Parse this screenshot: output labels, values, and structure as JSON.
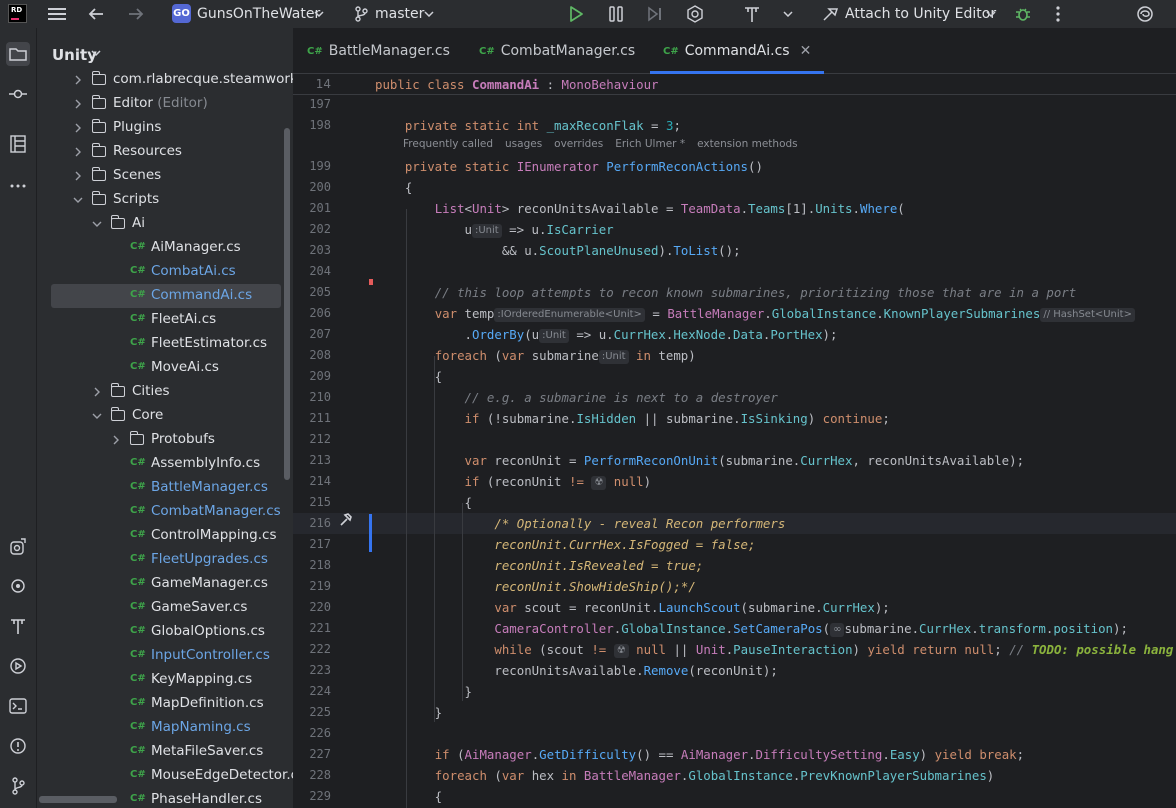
{
  "toolbar": {
    "logo_text": "RD",
    "project_badge": "GO",
    "project_name": "GunsOnTheWater",
    "branch": "master",
    "attach_label": "Attach to Unity Editor"
  },
  "project_panel": {
    "title": "Unity",
    "items": [
      {
        "label": "com.rlabrecque.steamworks.n",
        "kind": "folder",
        "depth": 1,
        "expanded": false,
        "color": "normal",
        "suffix": ""
      },
      {
        "label": "Editor",
        "kind": "folder",
        "depth": 1,
        "expanded": false,
        "color": "normal",
        "suffix": "(Editor)"
      },
      {
        "label": "Plugins",
        "kind": "folder",
        "depth": 1,
        "expanded": false,
        "color": "normal",
        "suffix": ""
      },
      {
        "label": "Resources",
        "kind": "folder",
        "depth": 1,
        "expanded": false,
        "color": "normal",
        "suffix": ""
      },
      {
        "label": "Scenes",
        "kind": "folder",
        "depth": 1,
        "expanded": false,
        "color": "normal",
        "suffix": ""
      },
      {
        "label": "Scripts",
        "kind": "folder",
        "depth": 1,
        "expanded": true,
        "color": "normal",
        "suffix": ""
      },
      {
        "label": "Ai",
        "kind": "folder",
        "depth": 2,
        "expanded": true,
        "color": "normal",
        "suffix": ""
      },
      {
        "label": "AiManager.cs",
        "kind": "file",
        "depth": 3,
        "color": "normal",
        "suffix": ""
      },
      {
        "label": "CombatAi.cs",
        "kind": "file",
        "depth": 3,
        "color": "blue",
        "suffix": ""
      },
      {
        "label": "CommandAi.cs",
        "kind": "file",
        "depth": 3,
        "color": "blue",
        "suffix": "",
        "selected": true
      },
      {
        "label": "FleetAi.cs",
        "kind": "file",
        "depth": 3,
        "color": "normal",
        "suffix": ""
      },
      {
        "label": "FleetEstimator.cs",
        "kind": "file",
        "depth": 3,
        "color": "normal",
        "suffix": ""
      },
      {
        "label": "MoveAi.cs",
        "kind": "file",
        "depth": 3,
        "color": "normal",
        "suffix": ""
      },
      {
        "label": "Cities",
        "kind": "folder",
        "depth": 2,
        "expanded": false,
        "color": "normal",
        "suffix": ""
      },
      {
        "label": "Core",
        "kind": "folder",
        "depth": 2,
        "expanded": true,
        "color": "normal",
        "suffix": ""
      },
      {
        "label": "Protobufs",
        "kind": "folder",
        "depth": 3,
        "expanded": false,
        "color": "normal",
        "suffix": ""
      },
      {
        "label": "AssemblyInfo.cs",
        "kind": "file",
        "depth": 3,
        "color": "normal",
        "suffix": ""
      },
      {
        "label": "BattleManager.cs",
        "kind": "file",
        "depth": 3,
        "color": "blue",
        "suffix": ""
      },
      {
        "label": "CombatManager.cs",
        "kind": "file",
        "depth": 3,
        "color": "blue",
        "suffix": ""
      },
      {
        "label": "ControlMapping.cs",
        "kind": "file",
        "depth": 3,
        "color": "normal",
        "suffix": ""
      },
      {
        "label": "FleetUpgrades.cs",
        "kind": "file",
        "depth": 3,
        "color": "blue",
        "suffix": ""
      },
      {
        "label": "GameManager.cs",
        "kind": "file",
        "depth": 3,
        "color": "normal",
        "suffix": ""
      },
      {
        "label": "GameSaver.cs",
        "kind": "file",
        "depth": 3,
        "color": "normal",
        "suffix": ""
      },
      {
        "label": "GlobalOptions.cs",
        "kind": "file",
        "depth": 3,
        "color": "normal",
        "suffix": ""
      },
      {
        "label": "InputController.cs",
        "kind": "file",
        "depth": 3,
        "color": "blue",
        "suffix": ""
      },
      {
        "label": "KeyMapping.cs",
        "kind": "file",
        "depth": 3,
        "color": "normal",
        "suffix": ""
      },
      {
        "label": "MapDefinition.cs",
        "kind": "file",
        "depth": 3,
        "color": "normal",
        "suffix": ""
      },
      {
        "label": "MapNaming.cs",
        "kind": "file",
        "depth": 3,
        "color": "blue",
        "suffix": ""
      },
      {
        "label": "MetaFileSaver.cs",
        "kind": "file",
        "depth": 3,
        "color": "normal",
        "suffix": ""
      },
      {
        "label": "MouseEdgeDetector.cs",
        "kind": "file",
        "depth": 3,
        "color": "normal",
        "suffix": ""
      },
      {
        "label": "PhaseHandler.cs",
        "kind": "file",
        "depth": 3,
        "color": "normal",
        "suffix": ""
      }
    ]
  },
  "tabs": [
    {
      "label": "BattleManager.cs",
      "active": false
    },
    {
      "label": "CombatManager.cs",
      "active": false
    },
    {
      "label": "CommandAi.cs",
      "active": true
    }
  ],
  "tab_lang": "C#",
  "editor": {
    "sticky": {
      "line": "14",
      "tokens": [
        [
          "kw",
          "public "
        ],
        [
          "kw",
          "class "
        ],
        [
          "tyb",
          "CommandAi"
        ],
        [
          "",
          "  : "
        ],
        [
          "ty",
          "MonoBehaviour"
        ]
      ]
    },
    "hints": [
      "Frequently called",
      "usages",
      "overrides",
      "Erich Ulmer *",
      "extension methods"
    ],
    "lines": [
      {
        "n": "197",
        "tokens": []
      },
      {
        "n": "198",
        "tokens": [
          [
            "",
            "    "
          ],
          [
            "kw",
            "private "
          ],
          [
            "kw",
            "static "
          ],
          [
            "kw",
            "int "
          ],
          [
            "fld",
            "_maxReconFlak"
          ],
          [
            "",
            " = "
          ],
          [
            "num",
            "3"
          ],
          [
            "",
            ";"
          ]
        ]
      },
      {
        "n": "",
        "hints": true
      },
      {
        "n": "199",
        "tokens": [
          [
            "",
            "    "
          ],
          [
            "kw",
            "private "
          ],
          [
            "kw",
            "static "
          ],
          [
            "ty",
            "IEnumerator "
          ],
          [
            "fn",
            "PerformReconActions"
          ],
          [
            "",
            "()"
          ]
        ]
      },
      {
        "n": "200",
        "tokens": [
          [
            "",
            "    {"
          ]
        ]
      },
      {
        "n": "201",
        "tokens": [
          [
            "",
            "        "
          ],
          [
            "ty",
            "List"
          ],
          [
            "",
            "<"
          ],
          [
            "ty",
            "Unit"
          ],
          [
            "",
            "> reconUnitsAvailable = "
          ],
          [
            "ty",
            "TeamData"
          ],
          [
            "",
            "."
          ],
          [
            "fld",
            "Teams"
          ],
          [
            "",
            "[1]."
          ],
          [
            "fld",
            "Units"
          ],
          [
            "",
            "."
          ],
          [
            "mt",
            "Where"
          ],
          [
            "",
            "("
          ]
        ]
      },
      {
        "n": "202",
        "tokens": [
          [
            "",
            "            u"
          ],
          [
            "inl",
            ":Unit"
          ],
          [
            "",
            " => u."
          ],
          [
            "fld",
            "IsCarrier"
          ]
        ]
      },
      {
        "n": "203",
        "tokens": [
          [
            "",
            "                 && u."
          ],
          [
            "fld",
            "ScoutPlaneUnused"
          ],
          [
            "",
            ")."
          ],
          [
            "mt",
            "ToList"
          ],
          [
            "",
            "();"
          ]
        ]
      },
      {
        "n": "204",
        "tokens": []
      },
      {
        "n": "205",
        "tokens": [
          [
            "",
            "        "
          ],
          [
            "cm",
            "// this loop attempts to recon known submarines, prioritizing those that are in a port"
          ]
        ]
      },
      {
        "n": "206",
        "tokens": [
          [
            "",
            "        "
          ],
          [
            "kw",
            "var "
          ],
          [
            "",
            "temp"
          ],
          [
            "inl",
            ":IOrderedEnumerable<Unit>"
          ],
          [
            "",
            " = "
          ],
          [
            "ty",
            "BattleManager"
          ],
          [
            "",
            "."
          ],
          [
            "fld",
            "GlobalInstance"
          ],
          [
            "",
            "."
          ],
          [
            "fld",
            "KnownPlayerSubmarines"
          ],
          [
            "inl",
            "// HashSet<Unit>"
          ]
        ]
      },
      {
        "n": "207",
        "tokens": [
          [
            "",
            "            ."
          ],
          [
            "mt",
            "OrderBy"
          ],
          [
            "",
            "(u"
          ],
          [
            "inl",
            ":Unit"
          ],
          [
            "",
            " => u."
          ],
          [
            "fld",
            "CurrHex"
          ],
          [
            "",
            "."
          ],
          [
            "fld",
            "HexNode"
          ],
          [
            "",
            "."
          ],
          [
            "fld",
            "Data"
          ],
          [
            "",
            "."
          ],
          [
            "fld",
            "PortHex"
          ],
          [
            "",
            ");"
          ]
        ]
      },
      {
        "n": "208",
        "tokens": [
          [
            "",
            "        "
          ],
          [
            "kw",
            "foreach "
          ],
          [
            "",
            "("
          ],
          [
            "kw",
            "var "
          ],
          [
            "",
            "submarine"
          ],
          [
            "inl",
            ":Unit"
          ],
          [
            "kw",
            " in "
          ],
          [
            "",
            "temp)"
          ]
        ]
      },
      {
        "n": "209",
        "tokens": [
          [
            "",
            "        {"
          ]
        ]
      },
      {
        "n": "210",
        "tokens": [
          [
            "",
            "            "
          ],
          [
            "cm",
            "// e.g. a submarine is next to a destroyer"
          ]
        ]
      },
      {
        "n": "211",
        "tokens": [
          [
            "",
            "            "
          ],
          [
            "kw",
            "if "
          ],
          [
            "",
            "(!submarine."
          ],
          [
            "fld",
            "IsHidden"
          ],
          [
            "",
            " || submarine."
          ],
          [
            "fld",
            "IsSinking"
          ],
          [
            "",
            ") "
          ],
          [
            "kw",
            "continue"
          ],
          [
            "",
            ";"
          ]
        ]
      },
      {
        "n": "212",
        "tokens": []
      },
      {
        "n": "213",
        "tokens": [
          [
            "",
            "            "
          ],
          [
            "kw",
            "var "
          ],
          [
            "",
            "reconUnit = "
          ],
          [
            "fn",
            "PerformReconOnUnit"
          ],
          [
            "",
            "(submarine."
          ],
          [
            "fld",
            "CurrHex"
          ],
          [
            "",
            ", reconUnitsAvailable);"
          ]
        ]
      },
      {
        "n": "214",
        "tokens": [
          [
            "",
            "            "
          ],
          [
            "kw",
            "if "
          ],
          [
            "",
            "(reconUnit "
          ],
          [
            "kw",
            "!= "
          ],
          [
            "inl",
            "☢"
          ],
          [
            "kw",
            " null"
          ],
          [
            "",
            ")"
          ]
        ]
      },
      {
        "n": "215",
        "tokens": [
          [
            "",
            "            {"
          ]
        ]
      },
      {
        "n": "216",
        "tokens": [
          [
            "",
            "                "
          ],
          [
            "cmy",
            "/* Optionally - reveal Recon performers"
          ]
        ],
        "current": true,
        "hammer": true
      },
      {
        "n": "217",
        "tokens": [
          [
            "",
            "                "
          ],
          [
            "cmy",
            "reconUnit.CurrHex.IsFogged = false;"
          ]
        ]
      },
      {
        "n": "218",
        "tokens": [
          [
            "",
            "                "
          ],
          [
            "cmy",
            "reconUnit.IsRevealed = true;"
          ]
        ]
      },
      {
        "n": "219",
        "tokens": [
          [
            "",
            "                "
          ],
          [
            "cmy",
            "reconUnit.ShowHideShip();*/"
          ]
        ]
      },
      {
        "n": "220",
        "tokens": [
          [
            "",
            "                "
          ],
          [
            "kw",
            "var "
          ],
          [
            "",
            "scout = reconUnit."
          ],
          [
            "mt",
            "LaunchScout"
          ],
          [
            "",
            "(submarine."
          ],
          [
            "fld",
            "CurrHex"
          ],
          [
            "",
            ");"
          ]
        ]
      },
      {
        "n": "221",
        "tokens": [
          [
            "",
            "                "
          ],
          [
            "ty",
            "CameraController"
          ],
          [
            "",
            "."
          ],
          [
            "fld",
            "GlobalInstance"
          ],
          [
            "",
            "."
          ],
          [
            "mt",
            "SetCameraPos"
          ],
          [
            "",
            "("
          ],
          [
            "inl",
            "∞"
          ],
          [
            "",
            "submarine."
          ],
          [
            "fld",
            "CurrHex"
          ],
          [
            "",
            "."
          ],
          [
            "fld",
            "transform"
          ],
          [
            "",
            "."
          ],
          [
            "fld",
            "position"
          ],
          [
            "",
            ");"
          ]
        ]
      },
      {
        "n": "222",
        "tokens": [
          [
            "",
            "                "
          ],
          [
            "kw",
            "while "
          ],
          [
            "",
            "(scout "
          ],
          [
            "kw",
            "!= "
          ],
          [
            "inl",
            "☢"
          ],
          [
            "kw",
            " null "
          ],
          [
            "",
            "|| "
          ],
          [
            "ty",
            "Unit"
          ],
          [
            "",
            "."
          ],
          [
            "fld",
            "PauseInteraction"
          ],
          [
            "",
            ") "
          ],
          [
            "kw",
            "yield return null"
          ],
          [
            "",
            "; "
          ],
          [
            "cm",
            "// "
          ],
          [
            "todo",
            "TODO: possible hang"
          ]
        ]
      },
      {
        "n": "223",
        "tokens": [
          [
            "",
            "                reconUnitsAvailable."
          ],
          [
            "mt",
            "Remove"
          ],
          [
            "",
            "(reconUnit);"
          ]
        ]
      },
      {
        "n": "224",
        "tokens": [
          [
            "",
            "            }"
          ]
        ]
      },
      {
        "n": "225",
        "tokens": [
          [
            "",
            "        }"
          ]
        ]
      },
      {
        "n": "226",
        "tokens": []
      },
      {
        "n": "227",
        "tokens": [
          [
            "",
            "        "
          ],
          [
            "kw",
            "if "
          ],
          [
            "",
            "("
          ],
          [
            "ty",
            "AiManager"
          ],
          [
            "",
            "."
          ],
          [
            "mt",
            "GetDifficulty"
          ],
          [
            "",
            "() == "
          ],
          [
            "ty",
            "AiManager"
          ],
          [
            "",
            "."
          ],
          [
            "ty",
            "DifficultySetting"
          ],
          [
            "",
            "."
          ],
          [
            "fld",
            "Easy"
          ],
          [
            "",
            ") "
          ],
          [
            "kw",
            "yield break"
          ],
          [
            "",
            ";"
          ]
        ]
      },
      {
        "n": "228",
        "tokens": [
          [
            "",
            "        "
          ],
          [
            "kw",
            "foreach "
          ],
          [
            "",
            "("
          ],
          [
            "kw",
            "var "
          ],
          [
            "",
            "hex "
          ],
          [
            "kw",
            "in "
          ],
          [
            "ty",
            "BattleManager"
          ],
          [
            "",
            "."
          ],
          [
            "fld",
            "GlobalInstance"
          ],
          [
            "",
            "."
          ],
          [
            "fld",
            "PrevKnownPlayerSubmarines"
          ],
          [
            "",
            ")"
          ]
        ]
      },
      {
        "n": "229",
        "tokens": [
          [
            "",
            "        {"
          ]
        ]
      }
    ]
  }
}
